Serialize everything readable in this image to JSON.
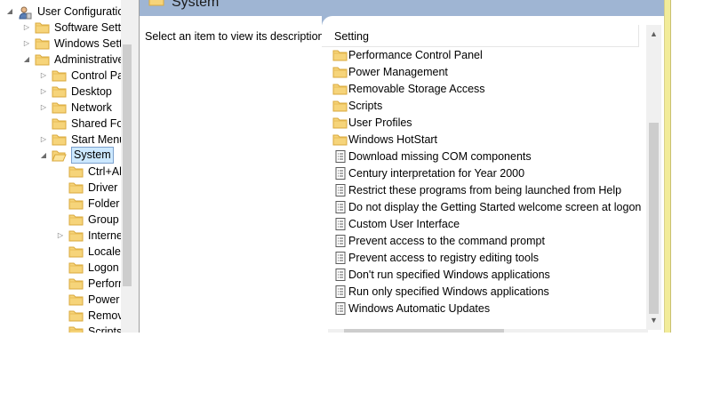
{
  "tree": {
    "items": [
      {
        "label": "User Configuration",
        "level": 0,
        "expander": "expanded",
        "icon": "user-config-icon"
      },
      {
        "label": "Software Settings",
        "level": 1,
        "expander": "collapsed",
        "icon": "folder-icon"
      },
      {
        "label": "Windows Settings",
        "level": 1,
        "expander": "collapsed",
        "icon": "folder-icon"
      },
      {
        "label": "Administrative Templates",
        "level": 1,
        "expander": "expanded",
        "icon": "folder-icon"
      },
      {
        "label": "Control Panel",
        "level": 2,
        "expander": "collapsed",
        "icon": "folder-icon"
      },
      {
        "label": "Desktop",
        "level": 2,
        "expander": "collapsed",
        "icon": "folder-icon"
      },
      {
        "label": "Network",
        "level": 2,
        "expander": "collapsed",
        "icon": "folder-icon"
      },
      {
        "label": "Shared Folders",
        "level": 2,
        "expander": "none",
        "icon": "folder-icon"
      },
      {
        "label": "Start Menu and Taskbar",
        "level": 2,
        "expander": "collapsed",
        "icon": "folder-icon"
      },
      {
        "label": "System",
        "level": 2,
        "expander": "expanded",
        "icon": "folder-open-icon",
        "selected": true
      },
      {
        "label": "Ctrl+Alt+Del Options",
        "level": 3,
        "expander": "none",
        "icon": "folder-icon"
      },
      {
        "label": "Driver Installation",
        "level": 3,
        "expander": "none",
        "icon": "folder-icon"
      },
      {
        "label": "Folder Redirection",
        "level": 3,
        "expander": "none",
        "icon": "folder-icon"
      },
      {
        "label": "Group Policy",
        "level": 3,
        "expander": "none",
        "icon": "folder-icon"
      },
      {
        "label": "Internet Communication Management",
        "level": 3,
        "expander": "collapsed",
        "icon": "folder-icon"
      },
      {
        "label": "Locale Services",
        "level": 3,
        "expander": "none",
        "icon": "folder-icon"
      },
      {
        "label": "Logon",
        "level": 3,
        "expander": "none",
        "icon": "folder-icon"
      },
      {
        "label": "Performance Control Panel",
        "level": 3,
        "expander": "none",
        "icon": "folder-icon"
      },
      {
        "label": "Power Management",
        "level": 3,
        "expander": "none",
        "icon": "folder-icon"
      },
      {
        "label": "Removable Storage Access",
        "level": 3,
        "expander": "none",
        "icon": "folder-icon"
      },
      {
        "label": "Scripts",
        "level": 3,
        "expander": "none",
        "icon": "folder-icon"
      }
    ]
  },
  "content": {
    "header_title": "System",
    "description": "Select an item to view its description.",
    "column_header": "Setting",
    "rows": [
      {
        "label": "Performance Control Panel",
        "icon": "folder-icon"
      },
      {
        "label": "Power Management",
        "icon": "folder-icon"
      },
      {
        "label": "Removable Storage Access",
        "icon": "folder-icon"
      },
      {
        "label": "Scripts",
        "icon": "folder-icon"
      },
      {
        "label": "User Profiles",
        "icon": "folder-icon"
      },
      {
        "label": "Windows HotStart",
        "icon": "folder-icon"
      },
      {
        "label": "Download missing COM components",
        "icon": "policy-setting-icon"
      },
      {
        "label": "Century interpretation for Year 2000",
        "icon": "policy-setting-icon"
      },
      {
        "label": "Restrict these programs from being launched from Help",
        "icon": "policy-setting-icon"
      },
      {
        "label": "Do not display the Getting Started welcome screen at logon",
        "icon": "policy-setting-icon"
      },
      {
        "label": "Custom User Interface",
        "icon": "policy-setting-icon"
      },
      {
        "label": "Prevent access to the command prompt",
        "icon": "policy-setting-icon"
      },
      {
        "label": "Prevent access to registry editing tools",
        "icon": "policy-setting-icon"
      },
      {
        "label": "Don't run specified Windows applications",
        "icon": "policy-setting-icon"
      },
      {
        "label": "Run only specified Windows applications",
        "icon": "policy-setting-icon"
      },
      {
        "label": "Windows Automatic Updates",
        "icon": "policy-setting-icon"
      }
    ]
  },
  "colors": {
    "header_band": "#9fb5d3",
    "selection": "#cce8ff",
    "folder": "#f6d47a",
    "window_edge": "#f2ec9a"
  }
}
